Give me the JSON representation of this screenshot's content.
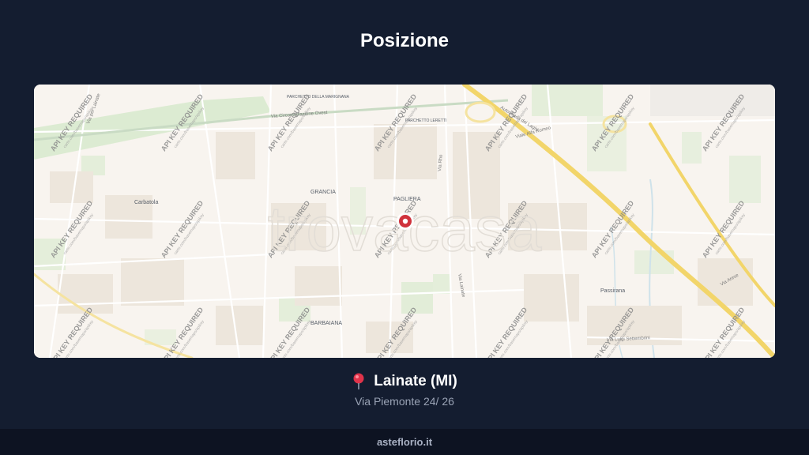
{
  "page": {
    "title": "Posizione"
  },
  "map": {
    "brand_watermark": "trovacasa",
    "tile_watermark_main": "API KEY REQUIRED",
    "tile_watermark_sub": "carto.com/basemaps/apikey",
    "places": [
      "Carbatola",
      "GRANCIA",
      "PAGLIERA",
      "Passirana",
      "BARBAIANA",
      "PARCHETTO LERETTI",
      "PARCHETTO DELLA MARIGNANA"
    ],
    "roads": [
      "Via Circonvallazione Ovest",
      "Autostrada dei Laghi",
      "Viale Alfa Romeo",
      "Via Rho",
      "Via Lainate",
      "Via Luigi Settembrini",
      "Via per Lainate",
      "Via Arese"
    ],
    "marker": {
      "color": "#d0323c",
      "icon": "location-marker-icon"
    },
    "colors": {
      "motorway": "#f2d56a",
      "green": "#d9ebcf",
      "water": "#cfe2ea"
    }
  },
  "location": {
    "icon": "pin-icon",
    "city": "Lainate (MI)",
    "address": "Via Piemonte 24/ 26"
  },
  "footer": {
    "brand": "asteflorio.it"
  }
}
